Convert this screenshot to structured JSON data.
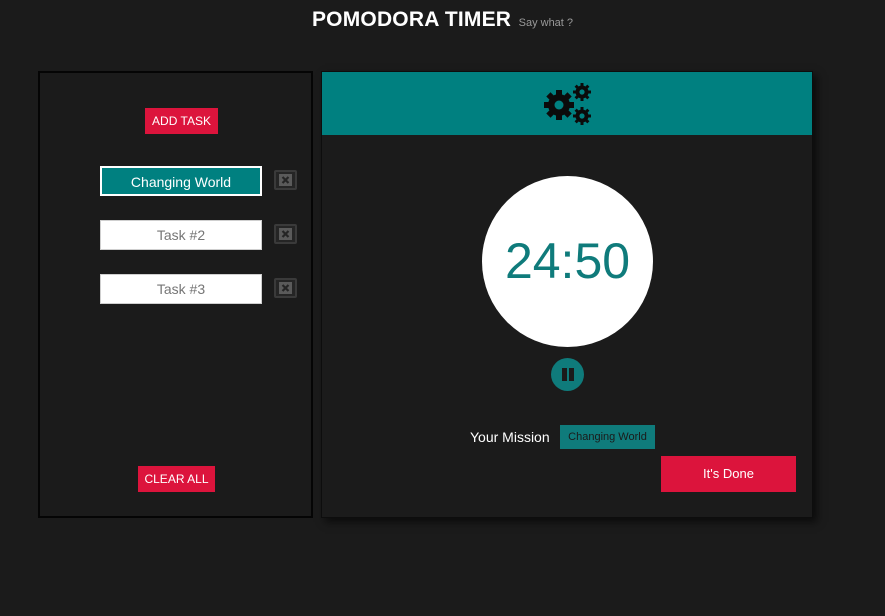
{
  "header": {
    "title": "POMODORA TIMER",
    "subtitle": "Say what ?"
  },
  "tasks_panel": {
    "add_label": "ADD TASK",
    "clear_label": "CLEAR ALL",
    "items": [
      {
        "value": "Changing World",
        "placeholder": "",
        "active": true
      },
      {
        "value": "",
        "placeholder": "Task #2",
        "active": false
      },
      {
        "value": "",
        "placeholder": "Task #3",
        "active": false
      }
    ]
  },
  "timer": {
    "icon": "gears-icon",
    "time": "24:50",
    "control_icon": "pause-icon",
    "mission_label": "Your Mission",
    "mission_value": "Changing World",
    "done_label": "It's Done"
  },
  "colors": {
    "background": "#1b1b1b",
    "accent": "#008080",
    "danger": "#dc143c"
  }
}
